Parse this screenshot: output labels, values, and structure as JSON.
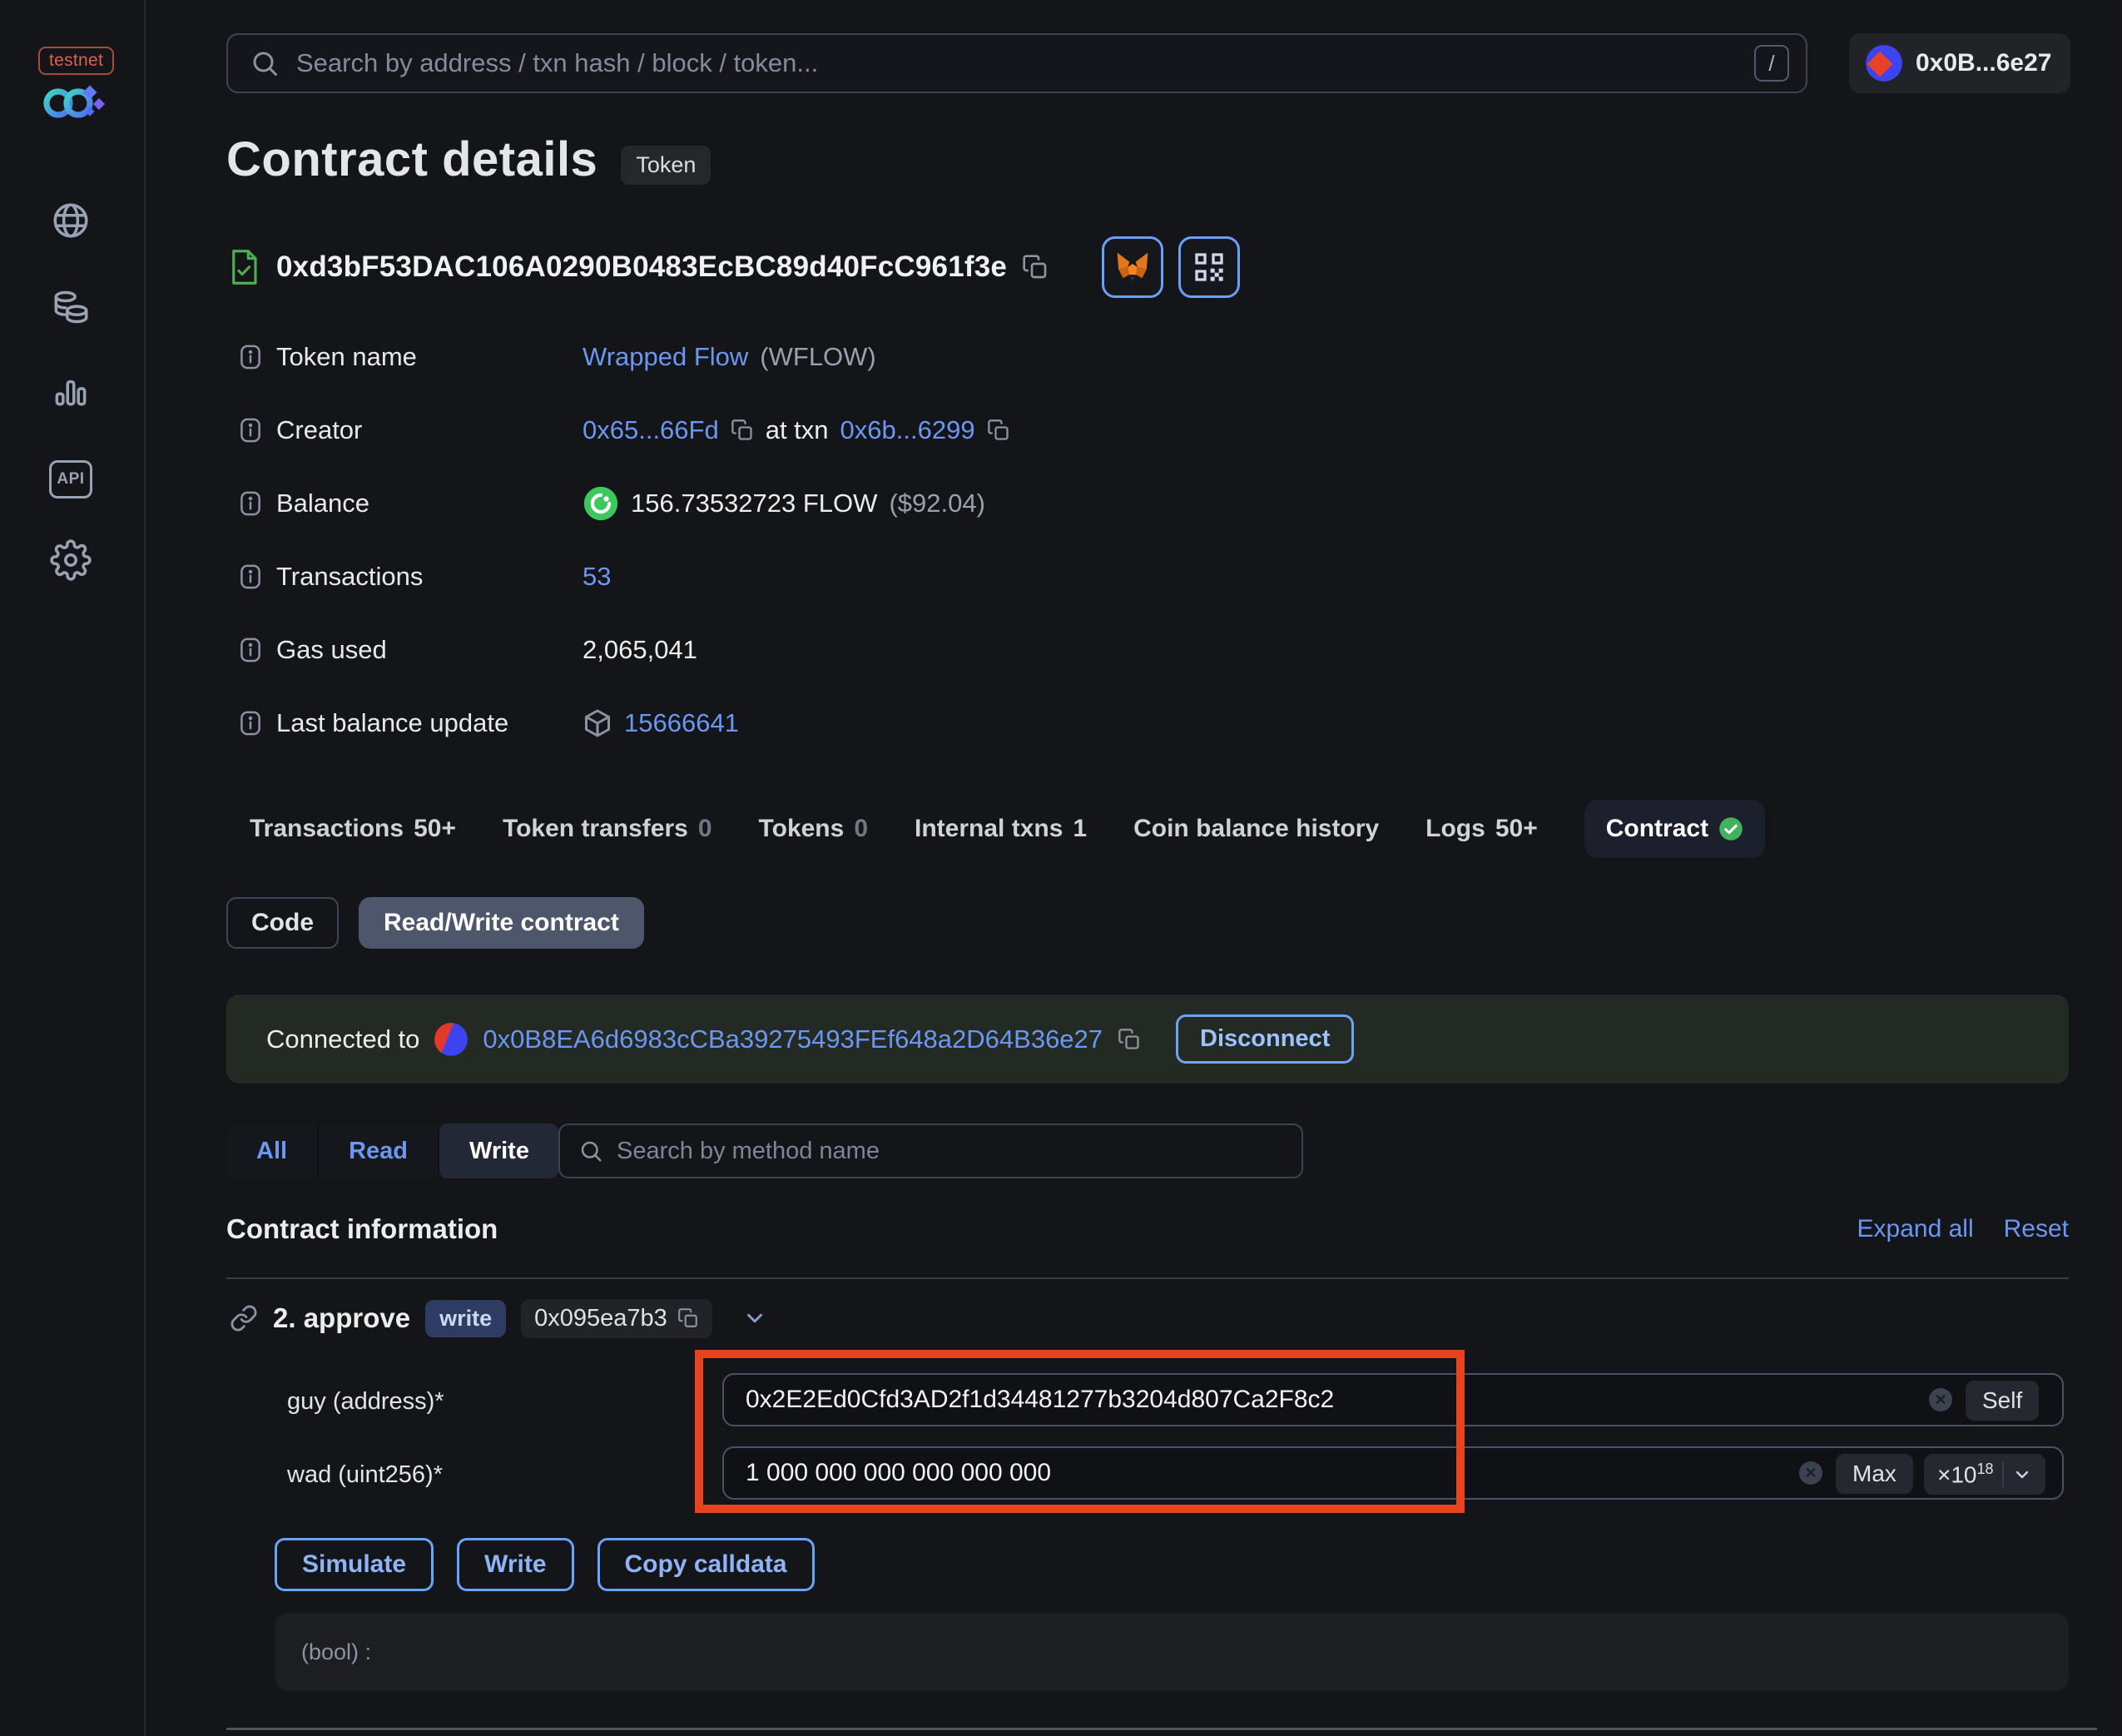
{
  "sidebar": {
    "env_badge": "testnet",
    "nav_icons": [
      "globe",
      "tokens",
      "stats",
      "api",
      "settings"
    ]
  },
  "topbar": {
    "search_placeholder": "Search by address / txn hash / block / token...",
    "search_shortcut": "/",
    "wallet_label": "0x0B...6e27"
  },
  "header": {
    "title": "Contract details",
    "type_badge": "Token",
    "address": "0xd3bF53DAC106A0290B0483EcBC89d40FcC961f3e"
  },
  "overview": {
    "token_name": {
      "label": "Token name",
      "link": "Wrapped Flow",
      "symbol": "(WFLOW)"
    },
    "creator": {
      "label": "Creator",
      "address": "0x65...66Fd",
      "mid": "at txn",
      "txn": "0x6b...6299"
    },
    "balance": {
      "label": "Balance",
      "value": "156.73532723 FLOW",
      "usd": "($92.04)"
    },
    "transactions": {
      "label": "Transactions",
      "value": "53"
    },
    "gas_used": {
      "label": "Gas used",
      "value": "2,065,041"
    },
    "last_balance_update": {
      "label": "Last balance update",
      "block": "15666641"
    }
  },
  "tabs": [
    {
      "label": "Transactions",
      "count": "50+"
    },
    {
      "label": "Token transfers",
      "count": "0"
    },
    {
      "label": "Tokens",
      "count": "0"
    },
    {
      "label": "Internal txns",
      "count": "1"
    },
    {
      "label": "Coin balance history",
      "count": ""
    },
    {
      "label": "Logs",
      "count": "50+"
    },
    {
      "label": "Contract",
      "count": ""
    }
  ],
  "contract_subnav": {
    "code": "Code",
    "read_write": "Read/Write contract"
  },
  "connection": {
    "prefix": "Connected to",
    "address": "0x0B8EA6d6983cCBa39275493FEf648a2D64B36e27",
    "disconnect": "Disconnect"
  },
  "method_filter": {
    "all": "All",
    "read": "Read",
    "write": "Write",
    "active": "Write",
    "search_placeholder": "Search by method name"
  },
  "section": {
    "title": "Contract information",
    "expand_all": "Expand all",
    "reset": "Reset"
  },
  "method": {
    "title": "2. approve",
    "badge": "write",
    "selector": "0x095ea7b3",
    "params": [
      {
        "label": "guy (address)*",
        "value": "0x2E2Ed0Cfd3AD2f1d34481277b3204d807Ca2F8c2",
        "action": "Self"
      },
      {
        "label": "wad (uint256)*",
        "value": "1 000 000 000 000 000 000",
        "action": "Max",
        "multiplier": "×10",
        "exponent": "18"
      }
    ],
    "buttons": {
      "simulate": "Simulate",
      "write": "Write",
      "copy_calldata": "Copy calldata"
    },
    "output": "(bool) :"
  },
  "annotation": {
    "shape": "rectangle",
    "color": "#e8431f"
  },
  "colors": {
    "accent_blue": "#6b97f2",
    "annotation_red": "#e8431f",
    "success_green": "#43b15e",
    "flow_green": "#3dc85e",
    "connected_bg": "#232a24"
  }
}
